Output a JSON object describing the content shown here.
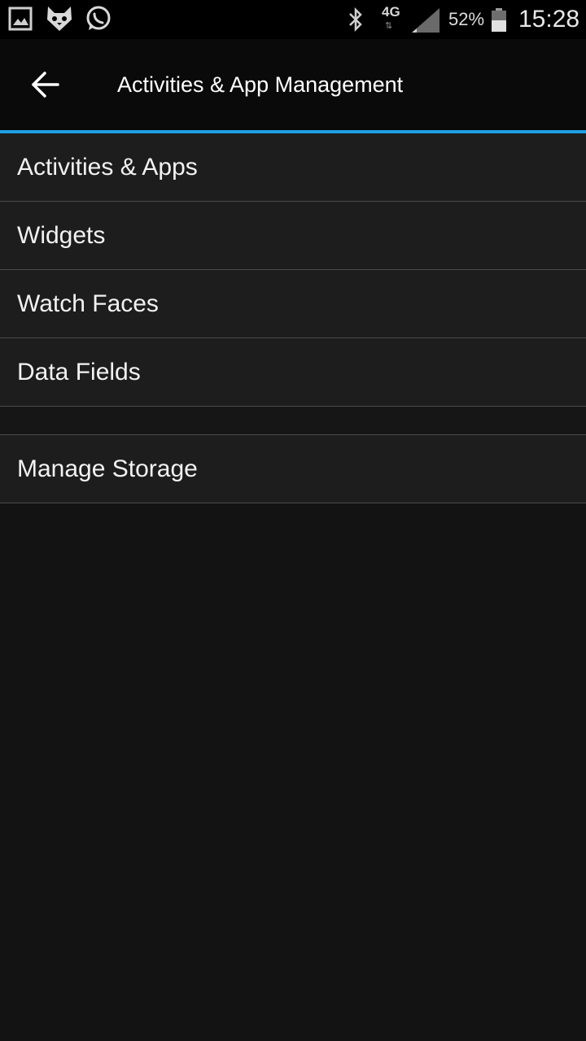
{
  "status_bar": {
    "icons_left": [
      "gallery-icon",
      "cat-app-icon",
      "whatsapp-icon"
    ],
    "bluetooth_icon": "bluetooth-icon",
    "network": "4G",
    "network_arrows": "⇅",
    "signal_icon": "signal-icon",
    "battery_percent": "52%",
    "battery_icon": "battery-icon",
    "time": "15:28"
  },
  "header": {
    "back_icon": "back-arrow-icon",
    "title": "Activities & App Management"
  },
  "colors": {
    "accent": "#1e9fe3",
    "background": "#131313",
    "item_background": "#1d1d1d"
  },
  "menu": {
    "items": [
      {
        "label": "Activities & Apps"
      },
      {
        "label": "Widgets"
      },
      {
        "label": "Watch Faces"
      },
      {
        "label": "Data Fields"
      }
    ],
    "storage": {
      "label": "Manage Storage"
    }
  }
}
